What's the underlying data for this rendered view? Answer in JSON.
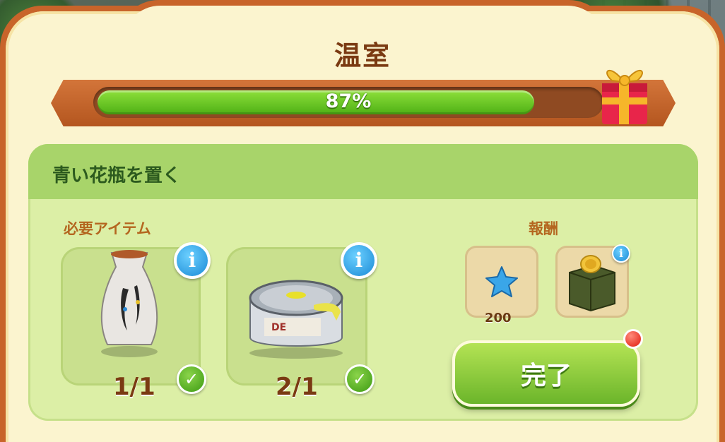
{
  "title": "温室",
  "progress": {
    "percent": 87,
    "label": "87%"
  },
  "task": {
    "title": "青い花瓶を置く",
    "required_label": "必要アイテム",
    "items": [
      {
        "name": "vase",
        "count": "1/1",
        "completed": true
      },
      {
        "name": "paint-can",
        "count": "2/1",
        "completed": true
      }
    ]
  },
  "rewards": {
    "label": "報酬",
    "items": [
      {
        "name": "star",
        "amount": "200"
      },
      {
        "name": "coin-box",
        "amount": ""
      }
    ]
  },
  "complete_button": {
    "label": "完了"
  },
  "colors": {
    "frame": "#c8642a",
    "progress_fill": "#4eb015",
    "panel": "#dcefa6",
    "button": "#8ccf3a",
    "notification": "#e01a0e"
  },
  "icons": [
    "gift-icon",
    "info-icon",
    "check-icon",
    "star-icon",
    "coin-box-icon",
    "vase-icon",
    "paint-can-icon"
  ]
}
